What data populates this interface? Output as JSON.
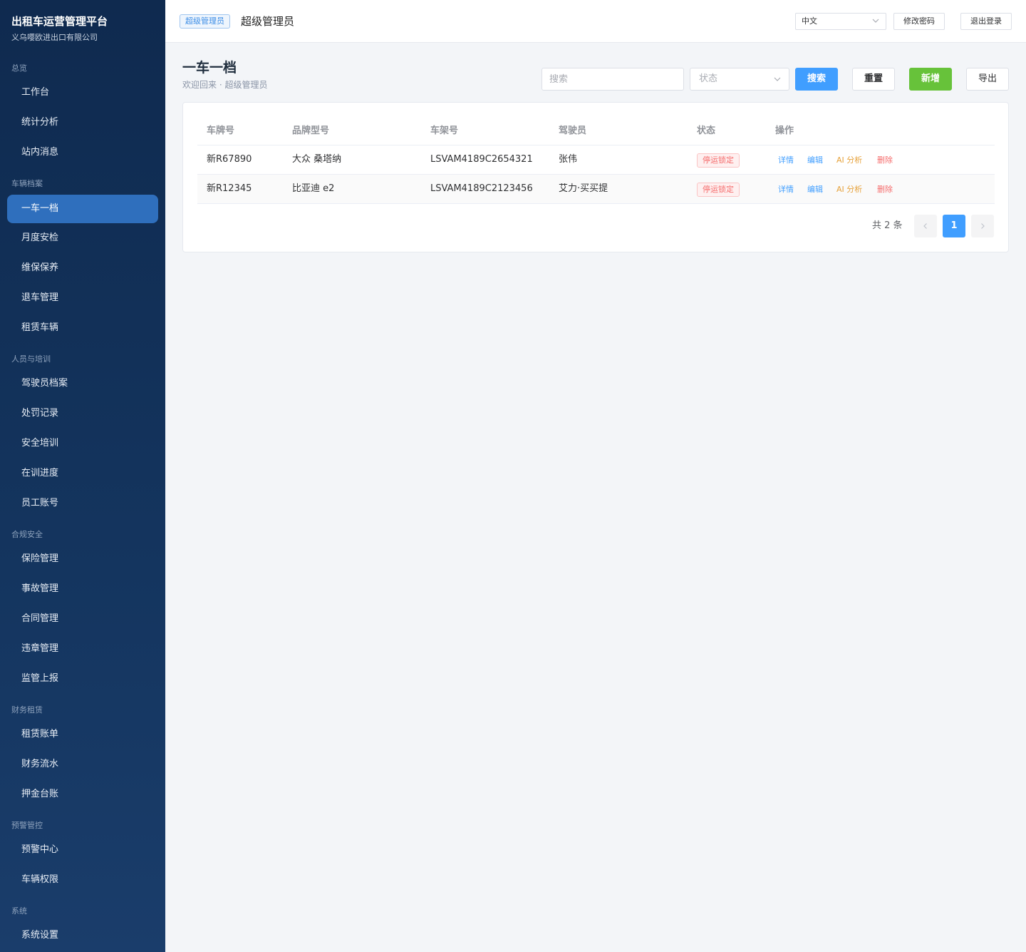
{
  "sidebar": {
    "title": "出租车运营管理平台",
    "company": "义乌嘤欧进出口有限公司",
    "sections": {
      "overview": "总览",
      "vehicle": "车辆档案",
      "people": "人员与培训",
      "compliance": "合规安全",
      "finance": "财务租赁",
      "warning": "预警管控",
      "system": "系统"
    },
    "items": {
      "workbench": "工作台",
      "stats": "统计分析",
      "messages": "站内消息",
      "one_car": "一车一档",
      "monthly_check": "月度安检",
      "maintenance": "维保保养",
      "return_car": "退车管理",
      "rental_cars": "租赁车辆",
      "drivers": "驾驶员档案",
      "penalties": "处罚记录",
      "safety_training": "安全培训",
      "training_progress": "在训进度",
      "staff_accounts": "员工账号",
      "insurance": "保险管理",
      "accidents": "事故管理",
      "contracts": "合同管理",
      "violations": "违章管理",
      "reporting": "监管上报",
      "rental_bills": "租赁账单",
      "finance_flow": "财务流水",
      "deposit_ledger": "押金台账",
      "warning_center": "预警中心",
      "vehicle_permissions": "车辆权限",
      "settings": "系统设置"
    },
    "active_item": "one_car"
  },
  "topbar": {
    "role_badge": "超级管理员",
    "user_name": "超级管理员",
    "language": "中文",
    "change_password": "修改密码",
    "logout": "退出登录"
  },
  "page": {
    "title": "一车一档",
    "subtitle": "欢迎回来 · 超级管理员",
    "search_placeholder": "搜索",
    "status_placeholder": "状态",
    "search_btn": "搜索",
    "reset_btn": "重置",
    "add_btn": "新增",
    "export_btn": "导出"
  },
  "table": {
    "headers": {
      "plate": "车牌号",
      "model": "品牌型号",
      "vin": "车架号",
      "driver": "驾驶员",
      "status": "状态",
      "actions": "操作"
    },
    "rows": [
      {
        "plate": "新R67890",
        "model": "大众 桑塔纳",
        "vin": "LSVAM4189C2654321",
        "driver": "张伟",
        "status": "停运锁定"
      },
      {
        "plate": "新R12345",
        "model": "比亚迪 e2",
        "vin": "LSVAM4189C2123456",
        "driver": "艾力·买买提",
        "status": "停运锁定"
      }
    ],
    "actions": {
      "detail": "详情",
      "edit": "编辑",
      "ai": "AI 分析",
      "delete": "删除"
    }
  },
  "pagination": {
    "total_label": "共 2 条",
    "current_page": "1"
  },
  "colors": {
    "sidebar_bg": "#14355f",
    "active_item": "#2f6fbd",
    "primary": "#409eff",
    "success": "#67c23a",
    "danger": "#f56c6c",
    "warning": "#e6a23c"
  }
}
